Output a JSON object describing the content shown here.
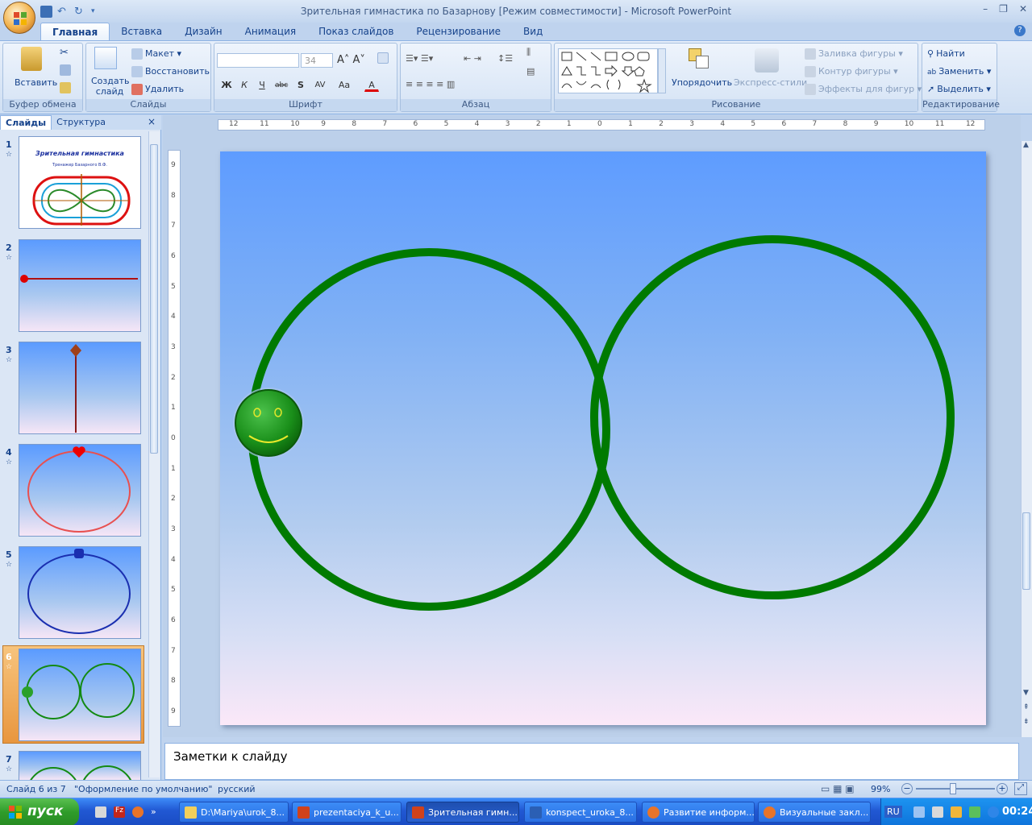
{
  "window": {
    "title": "Зрительная гимнастика по Базарнову [Режим совместимости] - Microsoft PowerPoint"
  },
  "tabs": [
    "Главная",
    "Вставка",
    "Дизайн",
    "Анимация",
    "Показ слайдов",
    "Рецензирование",
    "Вид"
  ],
  "ribbon": {
    "clipboard": {
      "paste": "Вставить",
      "label": "Буфер обмена"
    },
    "slides": {
      "create": "Создать слайд",
      "layout": "Макет",
      "reset": "Восстановить",
      "delete": "Удалить",
      "label": "Слайды"
    },
    "font": {
      "size": "34",
      "label": "Шрифт"
    },
    "paragraph": {
      "label": "Абзац"
    },
    "drawing": {
      "arrange": "Упорядочить",
      "styles": "Экспресс-стили",
      "fill": "Заливка фигуры",
      "outline": "Контур фигуры",
      "effects": "Эффекты для фигур",
      "label": "Рисование"
    },
    "editing": {
      "find": "Найти",
      "replace": "Заменить",
      "select": "Выделить",
      "label": "Редактирование"
    }
  },
  "pane": {
    "tab_slides": "Слайды",
    "tab_outline": "Структура",
    "thumb1_title": "Зрительная гимнастика",
    "thumb1_subtitle": "Тренажер Базарного В.Ф.",
    "slide_numbers": [
      "1",
      "2",
      "3",
      "4",
      "5",
      "6",
      "7"
    ]
  },
  "ruler": {
    "h_labels": [
      "12",
      "11",
      "10",
      "9",
      "8",
      "7",
      "6",
      "5",
      "4",
      "3",
      "2",
      "1",
      "0",
      "1",
      "2",
      "3",
      "4",
      "5",
      "6",
      "7",
      "8",
      "9",
      "10",
      "11",
      "12"
    ],
    "v_labels": [
      "9",
      "8",
      "7",
      "6",
      "5",
      "4",
      "3",
      "2",
      "1",
      "0",
      "1",
      "2",
      "3",
      "4",
      "5",
      "6",
      "7",
      "8",
      "9"
    ]
  },
  "notes": {
    "placeholder": "Заметки к слайду"
  },
  "status": {
    "slide": "Слайд 6 из 7",
    "theme": "\"Оформление по умолчанию\"",
    "lang": "русский",
    "zoom": "99%"
  },
  "taskbar": {
    "start": "пуск",
    "tasks": [
      "D:\\Mariya\\urok_8...",
      "prezentaciya_k_u...",
      "Зрительная гимн...",
      "konspect_uroka_8...",
      "Развитие информ...",
      "Визуальные закл..."
    ],
    "lang": "RU",
    "time": "00:24"
  },
  "colors": {
    "accent": "#15428b",
    "circle": "#007a00",
    "smiley": "#1f9e1f"
  }
}
